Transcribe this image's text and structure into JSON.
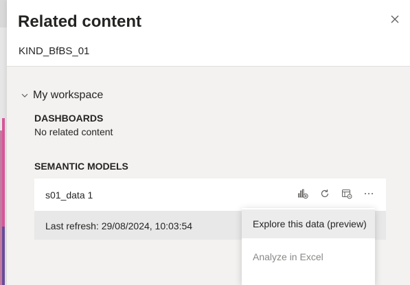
{
  "panel": {
    "title": "Related content",
    "subtitle": "KIND_BfBS_01"
  },
  "workspace": {
    "label": "My workspace"
  },
  "dashboards": {
    "heading": "DASHBOARDS",
    "empty_text": "No related content"
  },
  "semantic_models": {
    "heading": "SEMANTIC MODELS",
    "items": [
      {
        "name": "s01_data 1",
        "last_refresh": "Last refresh: 29/08/2024, 10:03:54",
        "actions": [
          "create-report-icon",
          "refresh-icon",
          "analyze-icon",
          "more-options-icon"
        ]
      }
    ]
  },
  "context_menu": {
    "items": [
      {
        "label": "Explore this data (preview)",
        "state": "hover"
      },
      {
        "label": "Analyze in Excel",
        "state": "disabled"
      }
    ]
  }
}
